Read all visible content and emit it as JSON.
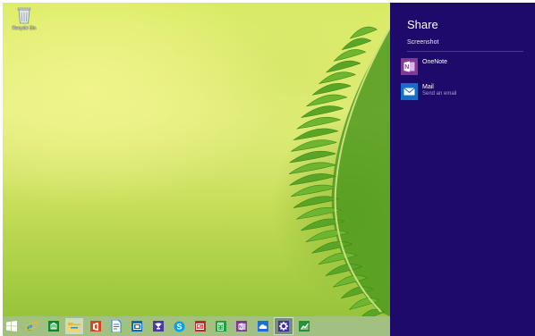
{
  "desktop": {
    "recycle_bin_label": "Recycle Bin"
  },
  "taskbar": {
    "buttons": [
      {
        "name": "start-button",
        "icon": "windows-logo-icon",
        "color": "#ffffff"
      },
      {
        "name": "internet-explorer-button",
        "icon": "internet-explorer-icon",
        "color": "#1e90e0"
      },
      {
        "name": "store-button",
        "icon": "store-icon",
        "color": "#0a8a2a"
      },
      {
        "name": "file-explorer-button",
        "icon": "folder-icon",
        "color": "#f2c83a"
      },
      {
        "name": "office-button",
        "icon": "office-icon",
        "color": "#d24726"
      },
      {
        "name": "notepad-button",
        "icon": "document-icon",
        "color": "#2a7fd4"
      },
      {
        "name": "movies-button",
        "icon": "film-icon",
        "color": "#0a6ab4"
      },
      {
        "name": "trophy-button",
        "icon": "trophy-icon",
        "color": "#4a3aa8"
      },
      {
        "name": "skype-button",
        "icon": "skype-icon",
        "color": "#00a3e6"
      },
      {
        "name": "news-button",
        "icon": "news-icon",
        "color": "#c6262e"
      },
      {
        "name": "calculator-button",
        "icon": "calculator-icon",
        "color": "#2e9a3c"
      },
      {
        "name": "onenote-button",
        "icon": "onenote-icon",
        "color": "#7e3b96"
      },
      {
        "name": "onedrive-button",
        "icon": "cloud-icon",
        "color": "#1d6fd6"
      },
      {
        "name": "settings-button",
        "icon": "gear-icon",
        "color": "#3d2fa4"
      },
      {
        "name": "finance-button",
        "icon": "chart-icon",
        "color": "#23913a"
      }
    ]
  },
  "share_pane": {
    "title": "Share",
    "subtitle": "Screenshot",
    "items": [
      {
        "name": "OneNote",
        "description": "",
        "icon": "onenote-icon",
        "color": "#7e3b96"
      },
      {
        "name": "Mail",
        "description": "Send an email",
        "icon": "mail-icon",
        "color": "#1470c6"
      }
    ]
  },
  "colors": {
    "charm_background": "#1e0a6a",
    "charm_secondary_text": "#a79fd3"
  }
}
